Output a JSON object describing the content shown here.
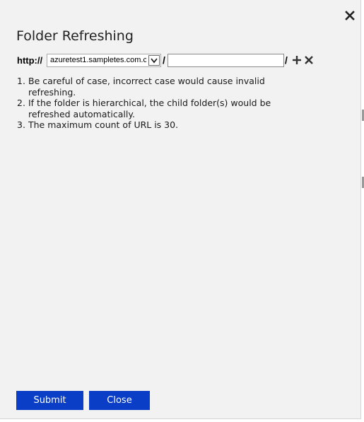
{
  "dialog": {
    "title": "Folder Refreshing",
    "close_icon": "close-icon"
  },
  "url_builder": {
    "prefix": "http://",
    "domain_select": {
      "selected": "azuretest1.sampletes.com.c"
    },
    "separator_1": "/",
    "path_input": {
      "value": "",
      "placeholder": ""
    },
    "separator_2": "/",
    "add_icon": "plus-icon",
    "remove_icon": "close-icon"
  },
  "notes": [
    {
      "num": "1.",
      "text": "Be careful of case, incorrect case would cause invalid refreshing."
    },
    {
      "num": "2.",
      "text": "If the folder is hierarchical, the child folder(s) would be refreshed automatically."
    },
    {
      "num": "3.",
      "text": "The maximum count of URL is 30."
    }
  ],
  "footer": {
    "submit_label": "Submit",
    "close_label": "Close"
  },
  "colors": {
    "dialog_bg": "#f2f2f2",
    "primary_button": "#0a3ec6",
    "button_text": "#ffffff"
  }
}
